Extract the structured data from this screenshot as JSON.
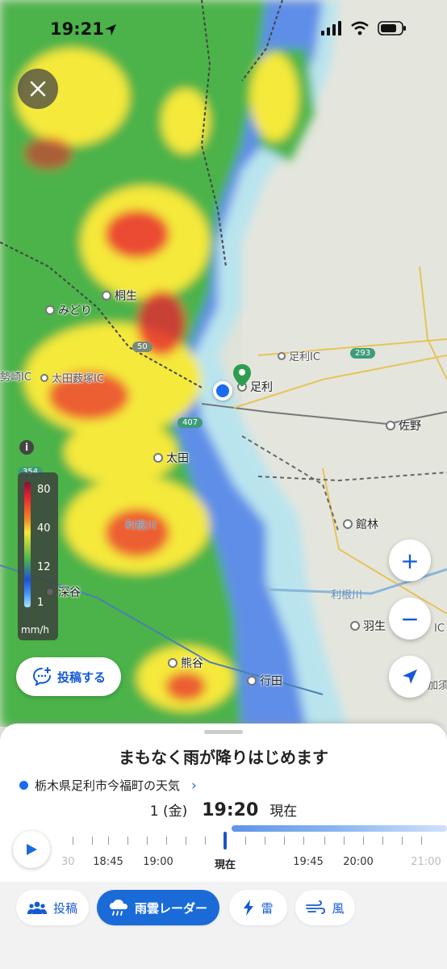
{
  "status_bar": {
    "time": "19:21"
  },
  "map": {
    "places": [
      {
        "id": "kiryu",
        "name": "桐生"
      },
      {
        "id": "midori",
        "name": "みどり"
      },
      {
        "id": "ashikaga_ic",
        "name": "足利IC"
      },
      {
        "id": "ashikaga",
        "name": "足利"
      },
      {
        "id": "ota_yabuzuka",
        "name": "太田薮塚IC"
      },
      {
        "id": "isezaki_ic",
        "name": "勢崎IC"
      },
      {
        "id": "sano",
        "name": "佐野"
      },
      {
        "id": "ota",
        "name": "太田"
      },
      {
        "id": "tatebayashi",
        "name": "館林"
      },
      {
        "id": "fukaya",
        "name": "深谷"
      },
      {
        "id": "hanyu",
        "name": "羽生"
      },
      {
        "id": "kumagaya",
        "name": "熊谷"
      },
      {
        "id": "gyoda",
        "name": "行田"
      },
      {
        "id": "kazo",
        "name": "加須"
      },
      {
        "id": "ic_partial",
        "name": "IC"
      }
    ],
    "rivers": {
      "tonegawa_left": "利根川",
      "tonegawa_right": "利根川"
    },
    "road_shields": {
      "r293": "293",
      "r407": "407",
      "r354": "354",
      "r50": "50"
    }
  },
  "legend": {
    "levels": [
      "80",
      "40",
      "12",
      "1"
    ],
    "unit": "mm/h",
    "info": "i"
  },
  "buttons": {
    "post": "投稿する",
    "zoom_in": "+",
    "zoom_out": "−"
  },
  "sheet": {
    "headline": "まもなく雨が降りはじめます",
    "location": "栃木県足利市今福町の天気",
    "date": "1 (金)",
    "time": "19:20",
    "now_label": "現在",
    "timeline_labels": [
      ":30",
      "18:45",
      "19:00",
      "現在",
      "19:45",
      "20:00",
      "21:00"
    ]
  },
  "tabs": [
    {
      "label": "投稿",
      "icon": "people-icon"
    },
    {
      "label": "雨雲レーダー",
      "icon": "rain-cloud-icon",
      "active": true
    },
    {
      "label": "雷",
      "icon": "lightning-icon"
    },
    {
      "label": "風",
      "icon": "wind-icon"
    }
  ],
  "colors": {
    "accent": "#1a6bd8",
    "rain_heavy": "#e8242f",
    "rain_mid": "#f5e93a",
    "rain_light": "#4bb34a",
    "rain_blue": "#3f8ef5"
  }
}
